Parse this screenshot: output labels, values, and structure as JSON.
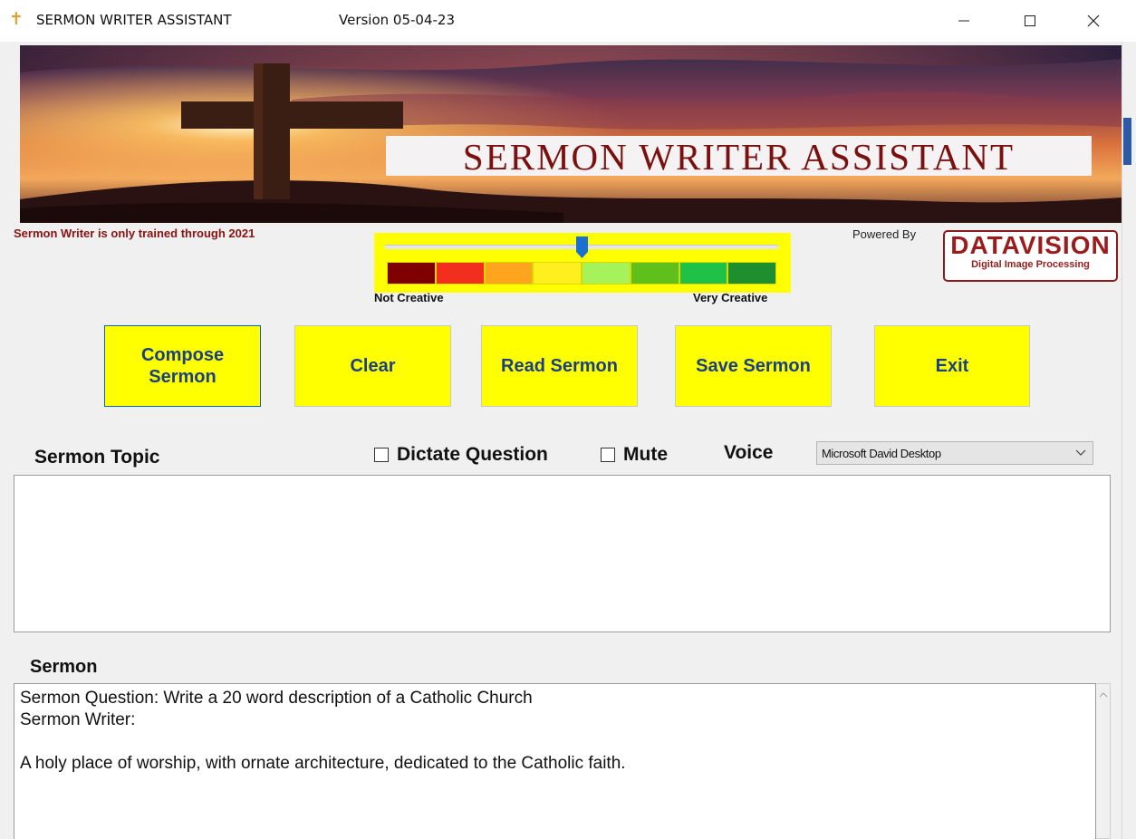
{
  "window": {
    "icon": "cross-icon",
    "title": "SERMON WRITER ASSISTANT",
    "version": "Version 05-04-23",
    "controls": [
      "minimize-icon",
      "maximize-icon",
      "close-icon"
    ]
  },
  "banner": {
    "title": "SERMON WRITER ASSISTANT"
  },
  "training_note": "Sermon Writer is only trained through 2021",
  "powered_by": {
    "label": "Powered By",
    "logo_main": "DATAVISION",
    "logo_sub": "Digital Image Processing"
  },
  "creativity": {
    "left_label": "Not Creative",
    "right_label": "Very Creative",
    "level": 0.5,
    "scale_colors": [
      "#7f0000",
      "#f22f1f",
      "#ffa41f",
      "#ffef1f",
      "#a5f25a",
      "#5fc01c",
      "#1fc246",
      "#1e8f2e"
    ]
  },
  "buttons": {
    "compose": "Compose Sermon",
    "clear": "Clear",
    "read": "Read Sermon",
    "save": "Save Sermon",
    "exit": "Exit"
  },
  "controls": {
    "topic_label": "Sermon Topic",
    "dictate_label": "Dictate Question",
    "mute_label": "Mute",
    "voice_label": "Voice",
    "voice_value": "Microsoft David Desktop",
    "dictate_checked": false,
    "mute_checked": false
  },
  "topic_text": "",
  "sermon": {
    "label": "Sermon",
    "lines": [
      "Sermon Question: Write a 20 word description of a Catholic Church",
      "Sermon Writer:",
      "",
      "A holy place of worship, with ornate architecture, dedicated to the Catholic faith."
    ]
  },
  "colors": {
    "button_bg": "#ffff00",
    "button_text": "#1a3f84",
    "banner_title": "#7a1010",
    "note_red": "#8b1212"
  }
}
